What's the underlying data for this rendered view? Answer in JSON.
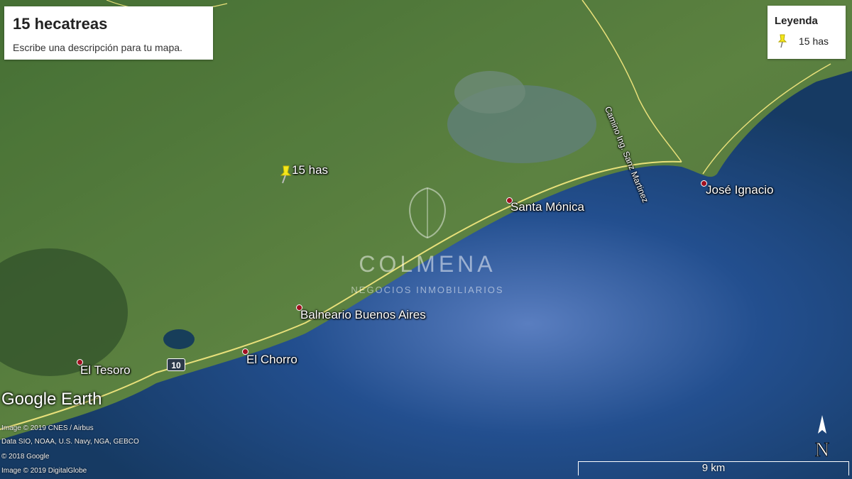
{
  "title": "15 hecatreas",
  "description": "Escribe una descripción para tu mapa.",
  "legend": {
    "title": "Leyenda",
    "items": [
      {
        "label": "15 has",
        "icon": "yellow-pushpin-icon",
        "color": "#f4e81c"
      }
    ]
  },
  "pin": {
    "label": "15 has"
  },
  "places": {
    "santa_monica": "Santa Mónica",
    "jose_ignacio": "José Ignacio",
    "balneario": "Balneario Buenos Aires",
    "el_chorro": "El Chorro",
    "el_tesoro": "El Tesoro"
  },
  "road_label": "Camino Ing. Sanz Martinez",
  "route_shield": "10",
  "watermark": {
    "name": "COLMENA",
    "tagline": "NEGOCIOS INMOBILIARIOS"
  },
  "brand": "Google Earth",
  "credits": [
    "Image © 2019 CNES / Airbus",
    "Data SIO, NOAA, U.S. Navy, NGA, GEBCO",
    "© 2018 Google",
    "Image © 2019 DigitalGlobe"
  ],
  "scale": "9 km",
  "north": "N",
  "colors": {
    "land": "#4f7a3a",
    "ocean": "#1c4a7a",
    "coast_road": "#e8e07a",
    "pin": "#f4e81c"
  }
}
